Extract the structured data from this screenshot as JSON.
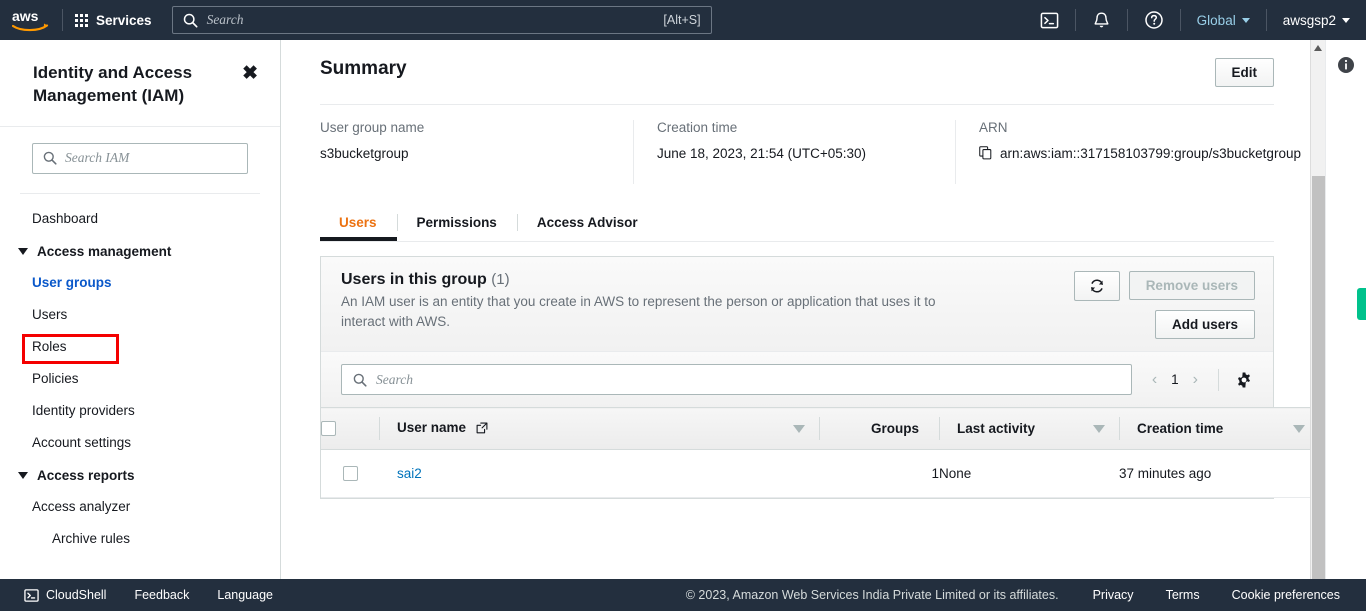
{
  "topnav": {
    "logo": "aws-logo",
    "services_label": "Services",
    "search": {
      "placeholder": "Search",
      "shortcut": "[Alt+S]",
      "value": ""
    },
    "cloudshell_icon": "cloudshell-icon",
    "notifications_icon": "bell-icon",
    "help_icon": "question-mark-icon",
    "region_label": "Global",
    "account_label": "awsgsp2"
  },
  "sidebar": {
    "title": "Identity and Access Management (IAM)",
    "close_icon": "close-icon",
    "search": {
      "placeholder": "Search IAM",
      "value": ""
    },
    "items": [
      {
        "label": "Dashboard",
        "type": "link",
        "indent": 0
      },
      {
        "label": "Access management",
        "type": "group",
        "indent": 0
      },
      {
        "label": "User groups",
        "type": "link",
        "indent": 0,
        "selected": true
      },
      {
        "label": "Users",
        "type": "link",
        "indent": 0
      },
      {
        "label": "Roles",
        "type": "link",
        "indent": 0
      },
      {
        "label": "Policies",
        "type": "link",
        "indent": 0
      },
      {
        "label": "Identity providers",
        "type": "link",
        "indent": 0
      },
      {
        "label": "Account settings",
        "type": "link",
        "indent": 0
      },
      {
        "label": "Access reports",
        "type": "group",
        "indent": 0
      },
      {
        "label": "Access analyzer",
        "type": "link",
        "indent": 0
      },
      {
        "label": "Archive rules",
        "type": "link",
        "indent": 1
      }
    ],
    "highlight_color": "#f40000"
  },
  "main": {
    "page_title": "Summary",
    "edit_label": "Edit",
    "summary": [
      {
        "label": "User group name",
        "value": "s3bucketgroup"
      },
      {
        "label": "Creation time",
        "value": "June 18, 2023, 21:54 (UTC+05:30)"
      },
      {
        "label": "ARN",
        "value": "arn:aws:iam::317158103799:group/s3bucketgroup"
      }
    ],
    "tabs": [
      {
        "label": "Users",
        "active": true
      },
      {
        "label": "Permissions",
        "active": false
      },
      {
        "label": "Access Advisor",
        "active": false
      }
    ],
    "users_panel": {
      "title": "Users in this group",
      "count": "(1)",
      "description": "An IAM user is an entity that you create in AWS to represent the person or application that uses it to interact with AWS.",
      "refresh_icon": "refresh-icon",
      "remove_users_label": "Remove users",
      "add_users_label": "Add users",
      "search": {
        "placeholder": "Search",
        "value": ""
      },
      "pagination": {
        "prev": "‹",
        "page": "1",
        "next": "›"
      },
      "settings_icon": "gear-icon",
      "columns": [
        {
          "key": "user_name",
          "label": "User name",
          "sortable": true,
          "external_link": true
        },
        {
          "key": "groups",
          "label": "Groups",
          "sortable": false
        },
        {
          "key": "last_activity",
          "label": "Last activity",
          "sortable": true
        },
        {
          "key": "creation_time",
          "label": "Creation time",
          "sortable": true
        }
      ],
      "rows": [
        {
          "user_name": "sai2",
          "groups": "1",
          "last_activity": "None",
          "creation_time": "37 minutes ago"
        }
      ]
    }
  },
  "right_rail": {
    "info_icon": "info-icon",
    "feedback_tab_color": "#00c28c"
  },
  "footer": {
    "cloudshell_label": "CloudShell",
    "feedback_label": "Feedback",
    "language_label": "Language",
    "copyright": "© 2023, Amazon Web Services India Private Limited or its affiliates.",
    "privacy_label": "Privacy",
    "terms_label": "Terms",
    "cookie_label": "Cookie preferences"
  },
  "colors": {
    "nav_bg": "#232f3e",
    "accent_orange": "#ec7211",
    "link_blue": "#0073bb",
    "highlight_red": "#f40000"
  }
}
